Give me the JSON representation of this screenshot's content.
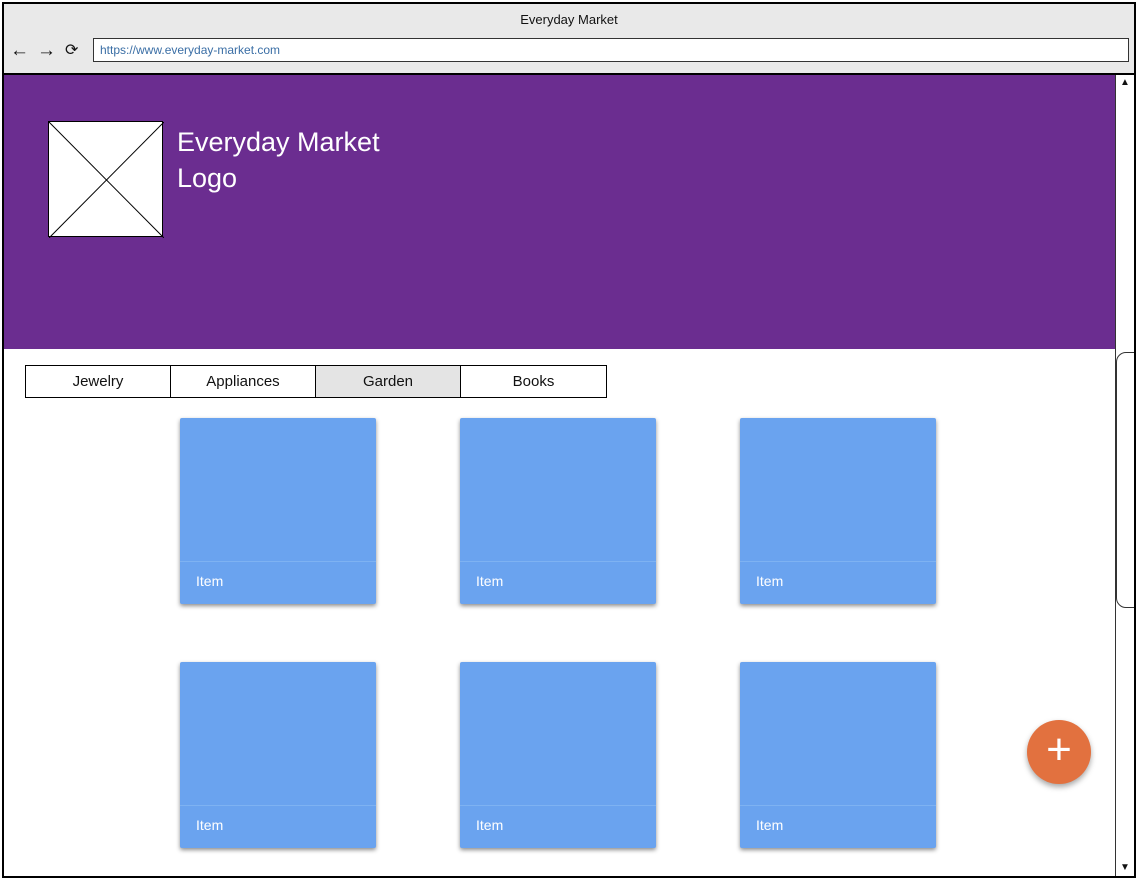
{
  "window": {
    "title": "Everyday Market",
    "url": "https://www.everyday-market.com"
  },
  "nav": {
    "back_icon": "←",
    "forward_icon": "→",
    "reload_icon": "⟳"
  },
  "header": {
    "logo_line1": "Everyday Market",
    "logo_line2": "Logo",
    "background_color": "#6b2d90"
  },
  "tabs": [
    {
      "label": "Jewelry",
      "active": false
    },
    {
      "label": "Appliances",
      "active": false
    },
    {
      "label": "Garden",
      "active": true
    },
    {
      "label": "Books",
      "active": false
    }
  ],
  "items": [
    {
      "label": "Item"
    },
    {
      "label": "Item"
    },
    {
      "label": "Item"
    },
    {
      "label": "Item"
    },
    {
      "label": "Item"
    },
    {
      "label": "Item"
    }
  ],
  "card_color": "#6aa3ef",
  "fab": {
    "icon": "+",
    "color": "#e2713f"
  },
  "scrollbar": {
    "up_icon": "▲",
    "down_icon": "▼"
  }
}
